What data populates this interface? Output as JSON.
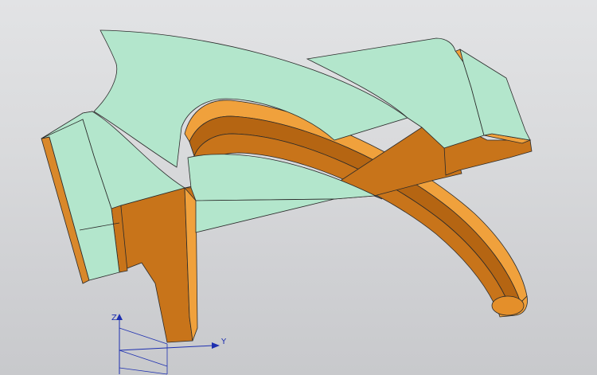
{
  "viewport": {
    "background_top": "#e2e3e5",
    "background_bottom": "#c8c9cc"
  },
  "model": {
    "face_color": "#b3e6cc",
    "body_color": "#c8741a",
    "highlight_color": "#f0a13c",
    "shadow_color": "#a75d12",
    "edge_color": "#2a2a2a"
  },
  "triad": {
    "color": "#1d2fb0",
    "z_label": "Z",
    "y_label": "Y"
  }
}
